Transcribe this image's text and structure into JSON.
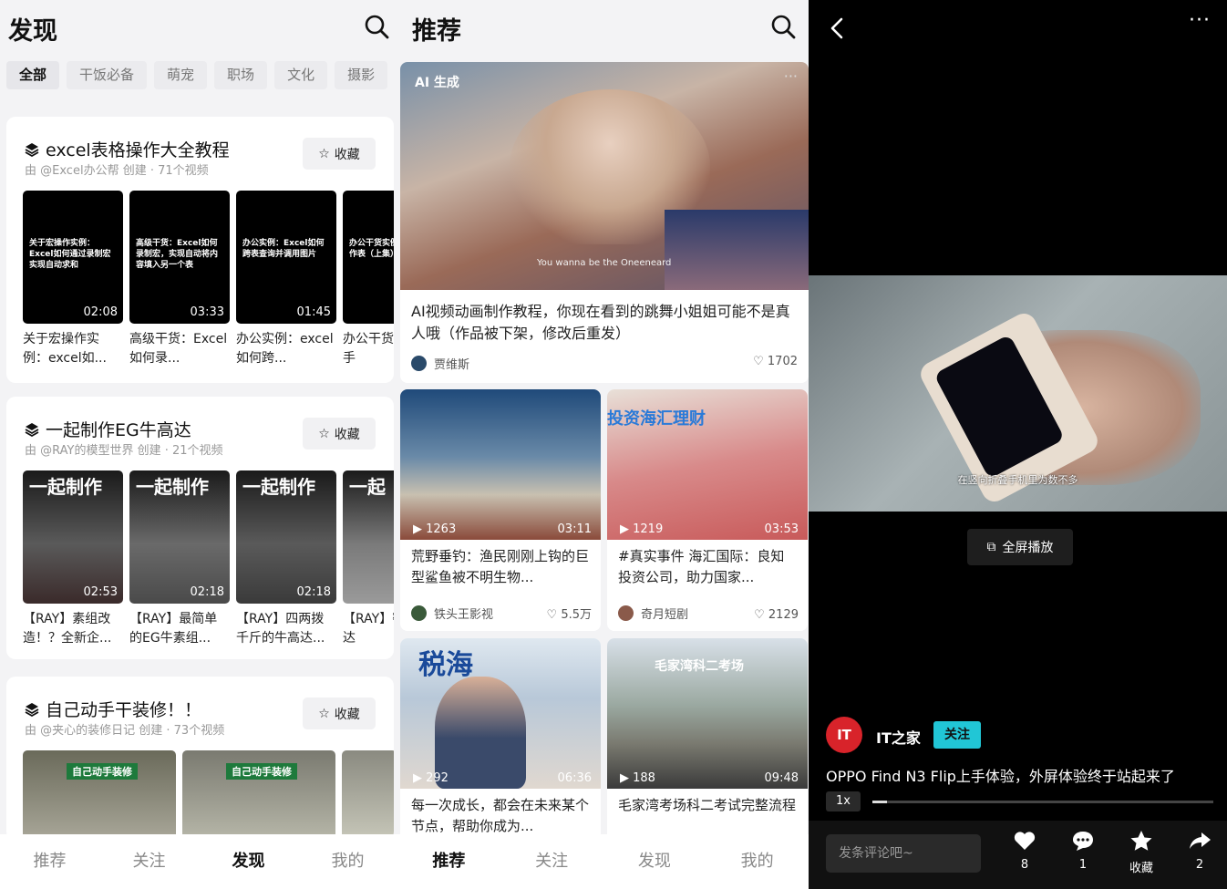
{
  "discover": {
    "title": "发现",
    "chips": [
      "全部",
      "干饭必备",
      "萌宠",
      "职场",
      "文化",
      "摄影"
    ],
    "collections": [
      {
        "title": "excel表格操作大全教程",
        "sub": "由 @Excel办公帮 创建 · 71个视频",
        "fav": "收藏",
        "videos": [
          {
            "thumb": "关于宏操作实例：Excel如何通过录制宏实现自动求和",
            "dur": "02:08",
            "cap": "关于宏操作实例：excel如..."
          },
          {
            "thumb": "高级干货：Excel如何录制宏，实现自动将内容填入另一个表",
            "dur": "03:33",
            "cap": "高级干货：Excel如何录..."
          },
          {
            "thumb": "办公实例：Excel如何跨表查询并调用图片",
            "dur": "01:45",
            "cap": "办公实例：excel如何跨..."
          },
          {
            "thumb": "办公干货实例手学会制作表（上集）",
            "dur": "",
            "cap": "办公干货快速上手"
          }
        ]
      },
      {
        "title": "一起制作EG牛高达",
        "sub": "由 @RAY的模型世界 创建 · 21个视频",
        "fav": "收藏",
        "videos": [
          {
            "thumb": "一起制作",
            "dur": "02:53",
            "cap": "【RAY】素组改造！？全新企..."
          },
          {
            "thumb": "一起制作",
            "dur": "02:18",
            "cap": "【RAY】最简单的EG牛素组..."
          },
          {
            "thumb": "一起制作",
            "dur": "02:18",
            "cap": "【RAY】四两拨千斤的牛高达..."
          },
          {
            "thumb": "一起",
            "dur": "",
            "cap": "【RAY】密的高达"
          }
        ]
      },
      {
        "title": "自己动手干装修！！",
        "sub": "由 @夹心的装修日记 创建 · 73个视频",
        "fav": "收藏",
        "videos": [
          {
            "thumb": "自己动手装修",
            "dur": "",
            "cap": ""
          },
          {
            "thumb": "自己动手装修",
            "dur": "",
            "cap": ""
          },
          {
            "thumb": "",
            "dur": "",
            "cap": ""
          }
        ]
      }
    ],
    "nav": [
      "推荐",
      "关注",
      "发现",
      "我的"
    ]
  },
  "recommend": {
    "title": "推荐",
    "featured": {
      "badge": "AI 生成",
      "caption": "You wanna be the Oneeneard",
      "title": "AI视频动画制作教程，你现在看到的跳舞小姐姐可能不是真人哦（作品被下架，修改后重发）",
      "author": "贾维斯",
      "likes": "1702"
    },
    "tiles": [
      {
        "views": "1263",
        "dur": "03:11",
        "title": "荒野垂钓：渔民刚刚上钩的巨型鲨鱼被不明生物...",
        "author": "铁头王影视",
        "likes": "5.5万",
        "overlay": ""
      },
      {
        "views": "1219",
        "dur": "03:53",
        "title": "#真实事件 海汇国际：良知投资公司，助力国家...",
        "author": "奇月短剧",
        "likes": "2129",
        "overlay": "投资海汇理财"
      },
      {
        "views": "292",
        "dur": "06:36",
        "title": "每一次成长，都会在未来某个节点，帮助你成为...",
        "author": "",
        "likes": "",
        "overlay": "税海"
      },
      {
        "views": "188",
        "dur": "09:48",
        "title": "毛家湾考场科二考试完整流程",
        "author": "",
        "likes": "",
        "overlay": "毛家湾科二考场"
      }
    ],
    "nav": [
      "推荐",
      "关注",
      "发现",
      "我的"
    ]
  },
  "player": {
    "subtitle": "在竖向折叠手机里为数不多",
    "fullscreen": "全屏播放",
    "channel": "IT之家",
    "follow": "关注",
    "title": "OPPO Find N3 Flip上手体验，外屏体验终于站起来了",
    "speed": "1x",
    "comment_placeholder": "发条评论吧~",
    "actions": [
      {
        "icon": "heart-icon",
        "label": "8"
      },
      {
        "icon": "comment-icon",
        "label": "1"
      },
      {
        "icon": "star-icon",
        "label": "收藏"
      },
      {
        "icon": "share-icon",
        "label": "2"
      }
    ]
  }
}
